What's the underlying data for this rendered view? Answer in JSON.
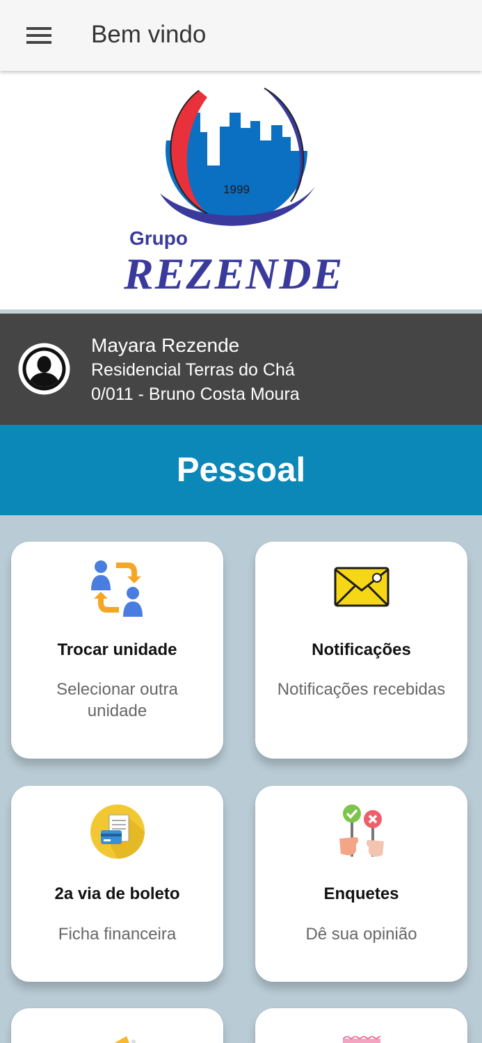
{
  "appbar": {
    "title": "Bem vindo",
    "menu_icon": "hamburger-menu-icon"
  },
  "logo": {
    "year": "1999",
    "group": "Grupo",
    "name": "REZENDE"
  },
  "profile": {
    "name": "Mayara Rezende",
    "condo": "Residencial Terras do Chá",
    "unit": "0/011 - Bruno Costa Moura"
  },
  "section": {
    "title": "Pessoal"
  },
  "cards": [
    {
      "title": "Trocar unidade",
      "subtitle": "Selecionar outra unidade",
      "icon": "swap-users-icon"
    },
    {
      "title": "Notificações",
      "subtitle": "Notificações recebidas",
      "icon": "envelope-icon"
    },
    {
      "title": "2a via de boleto",
      "subtitle": "Ficha financeira",
      "icon": "invoice-card-icon"
    },
    {
      "title": "Enquetes",
      "subtitle": "Dê sua opinião",
      "icon": "poll-vote-icon"
    }
  ],
  "colors": {
    "header_blue": "#0b88b8",
    "profile_bg": "#454545",
    "page_bg": "#b9cbd5",
    "logo_blue": "#0b6fc2",
    "logo_red": "#e8313a",
    "logo_navy": "#3a3a9c"
  }
}
